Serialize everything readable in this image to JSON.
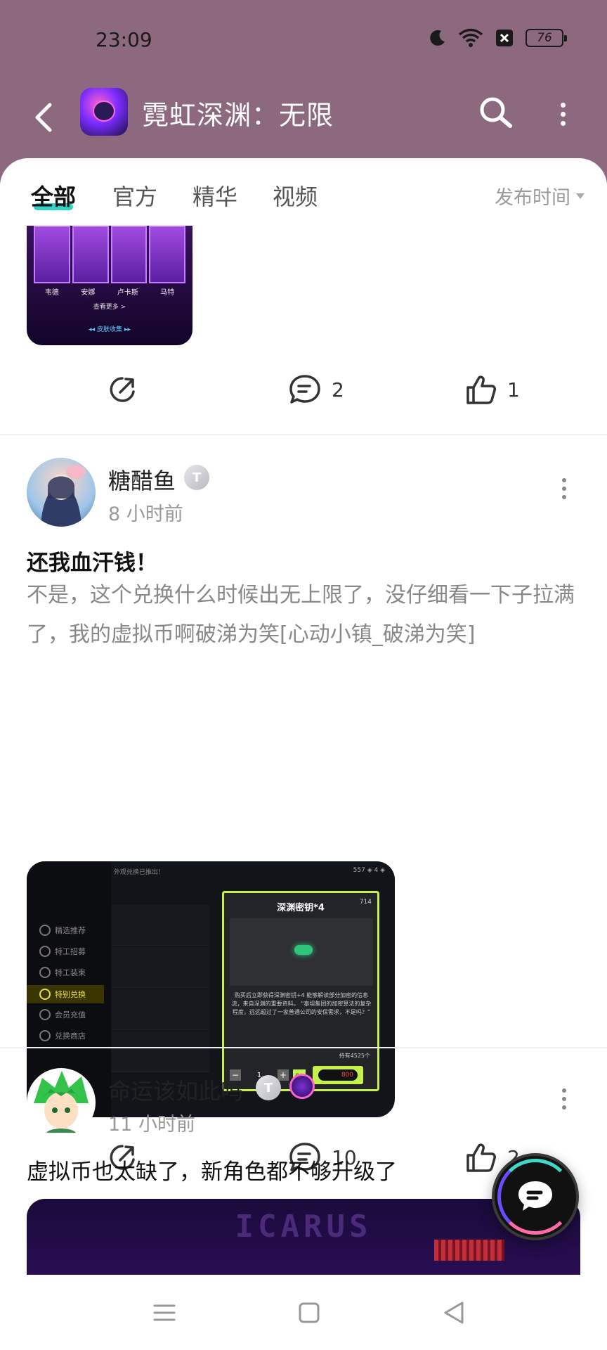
{
  "status_bar": {
    "time": "23:09",
    "battery": "76",
    "icons": [
      "moon-icon",
      "wifi-icon",
      "sim-off-icon",
      "battery-icon"
    ]
  },
  "header": {
    "title": "霓虹深渊：无限",
    "icons": [
      "back-icon",
      "game-icon",
      "search-icon",
      "more-icon"
    ]
  },
  "tabs": {
    "items": [
      {
        "label": "全部",
        "active": true
      },
      {
        "label": "官方",
        "active": false
      },
      {
        "label": "精华",
        "active": false
      },
      {
        "label": "视频",
        "active": false
      }
    ],
    "sort_label": "发布时间",
    "accent": "#2fd3c4"
  },
  "post1_partial": {
    "image": {
      "card_names": [
        "韦德",
        "安娜",
        "卢卡斯",
        "马特"
      ],
      "more_text": "查看更多 >",
      "collection_text": "◂◂ 皮肤收集 ▸▸"
    },
    "actions": {
      "share": "",
      "comments": "2",
      "likes": "1"
    }
  },
  "post2": {
    "username": "糖醋鱼",
    "badge": "T",
    "badge_level": "2",
    "time": "8 小时前",
    "title": "还我血汗钱！",
    "body": "不是，这个兑换什么时候出无上限了，没仔细看一下子拉满了，我的虚拟币啊破涕为笑[心动小镇_破涕为笑]",
    "image": {
      "menu": [
        "精选推荐",
        "特工招募",
        "特工装束",
        "特别兑换",
        "会员充值",
        "兑换商店"
      ],
      "selected_menu": "特别兑换",
      "header_hint": "外观兑换已推出！",
      "top_right": "557 ◈  4 ◈",
      "modal_title": "深渊密钥*4",
      "modal_count": "714",
      "modal_desc": "购买后立即获得深渊密钥+4\n能够解读部分加密的信息流，来自深渊的重要资料。\n“泰坦集团的加密算法的复杂程度，远远超过了一家普通公司的安保需求，不是吗？”",
      "owned": "持有4525个",
      "quantity": "1",
      "max_label": "最大",
      "price": "800"
    },
    "actions": {
      "share": "",
      "comments": "10",
      "likes": "2"
    }
  },
  "post3": {
    "username": "命运该如此吗",
    "badge": "T",
    "badge_level": "3",
    "time": "11 小时前",
    "title": "虚拟币也太缺了，新角色都不够升级了",
    "image_text": "ICARUS"
  },
  "nav_bar": {
    "icons": [
      "menu-icon",
      "home-icon",
      "back-triangle-icon"
    ]
  }
}
